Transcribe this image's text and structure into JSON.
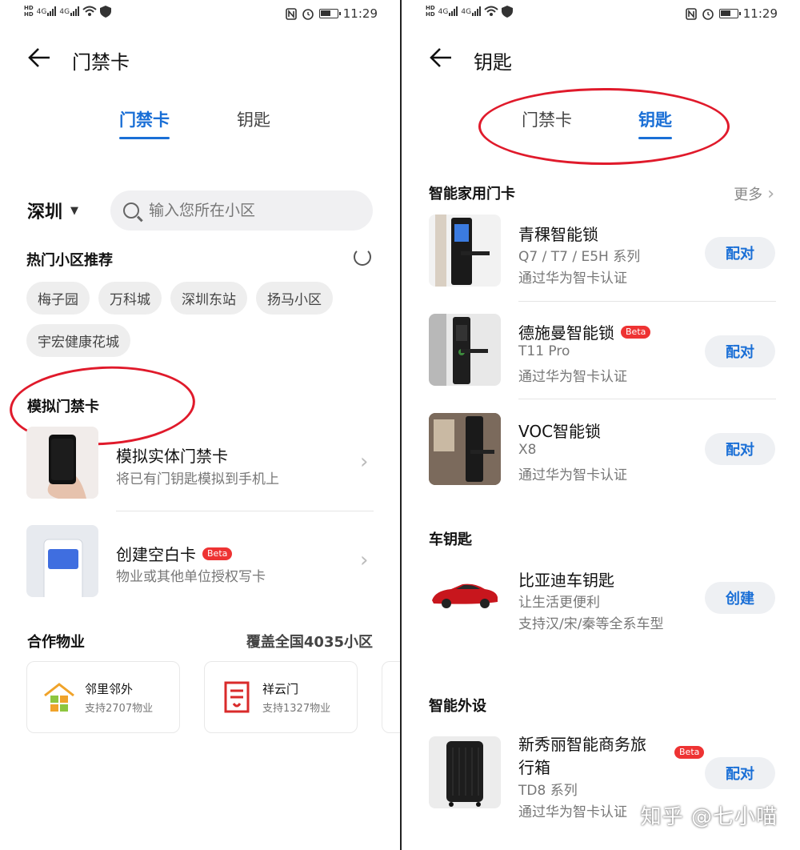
{
  "status_bar": {
    "hd": "HD",
    "net": "4G",
    "time": "11:29"
  },
  "left": {
    "title": "门禁卡",
    "tabs": [
      "门禁卡",
      "钥匙"
    ],
    "city": "深圳",
    "search_placeholder": "输入您所在小区",
    "hot_title": "热门小区推荐",
    "hot_chips": [
      "梅子园",
      "万科城",
      "深圳东站",
      "扬马小区",
      "宇宏健康花城"
    ],
    "sim_title": "模拟门禁卡",
    "items": [
      {
        "title": "模拟实体门禁卡",
        "subtitle": "将已有门钥匙模拟到手机上"
      },
      {
        "title": "创建空白卡",
        "badge": "Beta",
        "subtitle": "物业或其他单位授权写卡"
      }
    ],
    "partner_title": "合作物业",
    "partner_coverage": "覆盖全国4035小区",
    "partners": [
      {
        "name": "邻里邻外",
        "count": "支持2707物业"
      },
      {
        "name": "祥云门",
        "count": "支持1327物业"
      }
    ]
  },
  "right": {
    "title": "钥匙",
    "tabs": [
      "门禁卡",
      "钥匙"
    ],
    "home_title": "智能家用门卡",
    "more_label": "更多",
    "locks": [
      {
        "title": "青稞智能锁",
        "line1": "Q7 / T7 / E5H 系列",
        "line2": "通过华为智卡认证",
        "button": "配对"
      },
      {
        "title": "德施曼智能锁",
        "badge": "Beta",
        "line1": "T11 Pro",
        "line2": "通过华为智卡认证",
        "button": "配对"
      },
      {
        "title": "VOC智能锁",
        "line1": "X8",
        "line2": "通过华为智卡认证",
        "button": "配对"
      }
    ],
    "car_title": "车钥匙",
    "car": {
      "title": "比亚迪车钥匙",
      "line1": "让生活更便利",
      "line2": "支持汉/宋/秦等全系车型",
      "button": "创建"
    },
    "device_title": "智能外设",
    "device": {
      "title_line1": "新秀丽智能商务旅",
      "title_line2": "行箱",
      "badge": "Beta",
      "line1": "TD8 系列",
      "line2": "通过华为智卡认证",
      "button": "配对"
    }
  },
  "watermark": "知乎 @七小喵",
  "colors": {
    "accent": "#1a6fd6",
    "highlight": "#e01a2b",
    "badge": "#e33333"
  }
}
